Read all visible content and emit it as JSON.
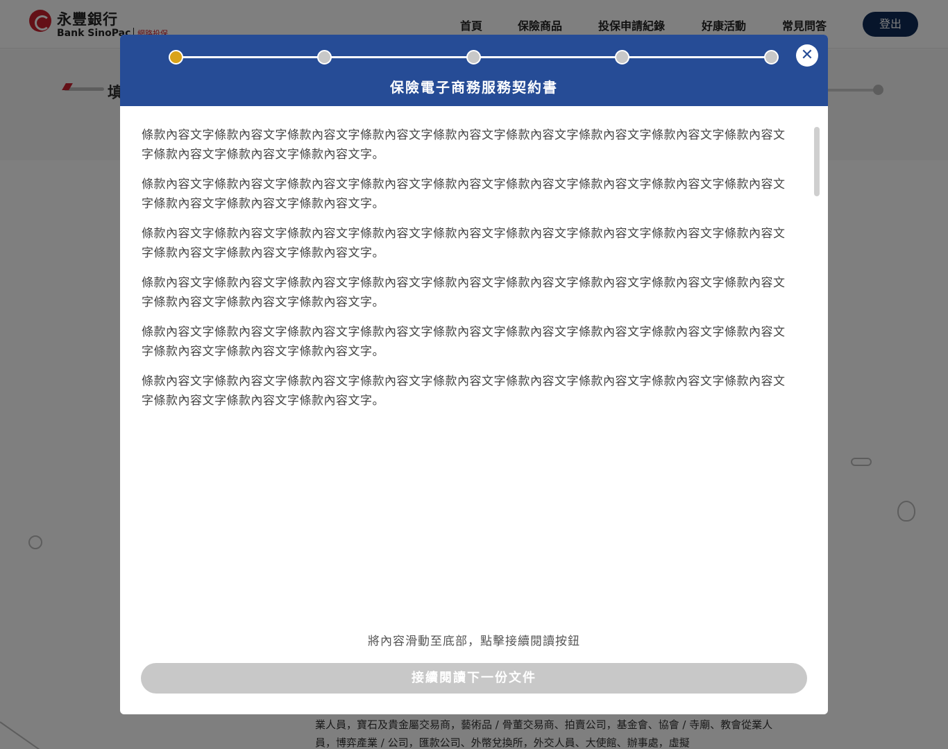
{
  "header": {
    "logo_zh": "永豐銀行",
    "logo_en": "Bank SinoPac",
    "logo_sub": "網路投保",
    "nav": [
      "首頁",
      "保險商品",
      "投保申請紀錄",
      "好康活動",
      "常見問答"
    ],
    "logout_label": "登出"
  },
  "background": {
    "section_title": "填",
    "body_text": "業人員，寶石及貴金屬交易商，藝術品 / 骨董交易商、拍賣公司，基金會、協會 / 寺廟、教會從業人員，博弈產業 / 公司，匯款公司、外幣兌換所，外交人員、大使館、辦事處，虛擬"
  },
  "modal": {
    "title": "保險電子商務服務契約書",
    "steps": {
      "total": 5,
      "current": 1
    },
    "paragraphs": [
      "條款內容文字條款內容文字條款內容文字條款內容文字條款內容文字條款內容文字條款內容文字條款內容文字條款內容文字條款內容文字條款內容文字條款內容文字。",
      "條款內容文字條款內容文字條款內容文字條款內容文字條款內容文字條款內容文字條款內容文字條款內容文字條款內容文字條款內容文字條款內容文字條款內容文字。",
      "條款內容文字條款內容文字條款內容文字條款內容文字條款內容文字條款內容文字條款內容文字條款內容文字條款內容文字條款內容文字條款內容文字條款內容文字。",
      "條款內容文字條款內容文字條款內容文字條款內容文字條款內容文字條款內容文字條款內容文字條款內容文字條款內容文字條款內容文字條款內容文字條款內容文字。",
      "條款內容文字條款內容文字條款內容文字條款內容文字條款內容文字條款內容文字條款內容文字條款內容文字條款內容文字條款內容文字條款內容文字條款內容文字。",
      "條款內容文字條款內容文字條款內容文字條款內容文字條款內容文字條款內容文字條款內容文字條款內容文字條款內容文字條款內容文字條款內容文字條款內容文字。"
    ],
    "scroll_hint": "將內容滑動至底部，點擊接續閱讀按鈕",
    "next_button_label": "接續閱讀下一份文件",
    "close_icon": "close-icon"
  },
  "colors": {
    "header_blue": "#264c96",
    "active_step": "#d9a31a",
    "inactive_step": "#c8c8c8",
    "disabled_button": "#c8c8c8",
    "logout_bg": "#0e2a56",
    "brand_red": "#c8202f"
  }
}
